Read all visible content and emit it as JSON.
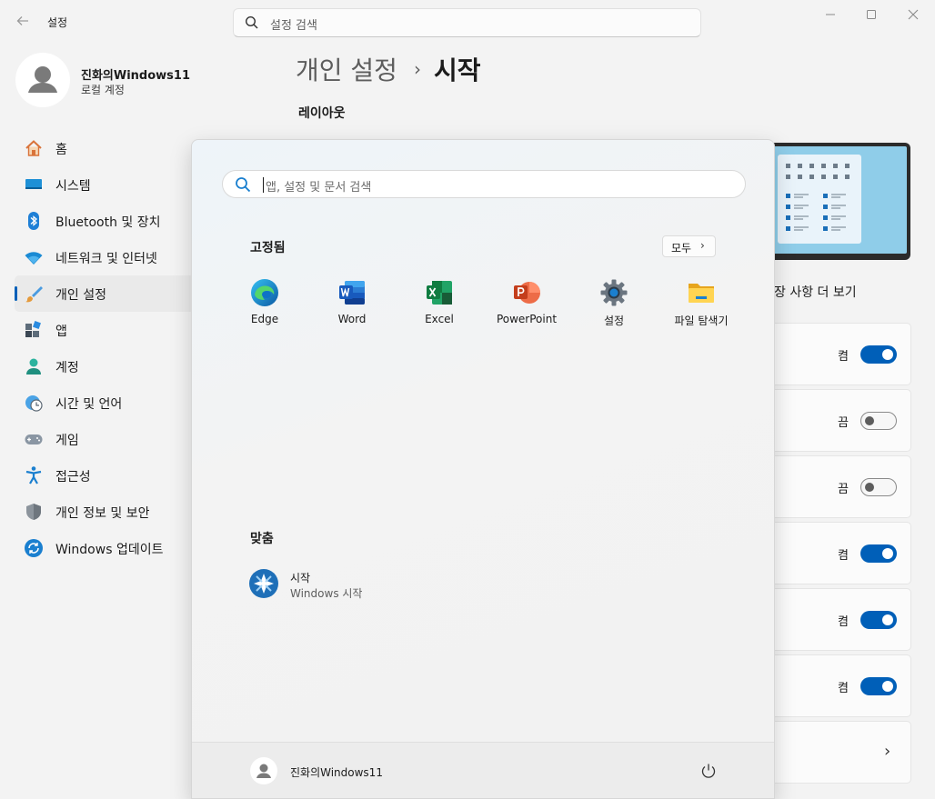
{
  "titlebar": {
    "app_title": "설정",
    "search_placeholder": "설정 검색"
  },
  "profile": {
    "name": "진화의Windows11",
    "account_type": "로컬 계정"
  },
  "sidebar": {
    "items": [
      {
        "label": "홈",
        "icon": "home-icon"
      },
      {
        "label": "시스템",
        "icon": "system-icon"
      },
      {
        "label": "Bluetooth 및 장치",
        "icon": "bluetooth-icon"
      },
      {
        "label": "네트워크 및 인터넷",
        "icon": "wifi-icon"
      },
      {
        "label": "개인 설정",
        "icon": "brush-icon",
        "active": true
      },
      {
        "label": "앱",
        "icon": "apps-icon"
      },
      {
        "label": "계정",
        "icon": "account-icon"
      },
      {
        "label": "시간 및 언어",
        "icon": "time-language-icon"
      },
      {
        "label": "게임",
        "icon": "gamepad-icon"
      },
      {
        "label": "접근성",
        "icon": "accessibility-icon"
      },
      {
        "label": "개인 정보 및 보안",
        "icon": "shield-icon"
      },
      {
        "label": "Windows 업데이트",
        "icon": "update-icon"
      }
    ]
  },
  "content": {
    "breadcrumb_parent": "개인 설정",
    "breadcrumb_current": "시작",
    "section_title": "레이아웃",
    "more_link": "장 사항 더 보기",
    "rows": [
      {
        "state": "켬",
        "on": true
      },
      {
        "state": "끔",
        "on": false
      },
      {
        "state": "끔",
        "on": false
      },
      {
        "state": "켬",
        "on": true
      },
      {
        "state": "켬",
        "on": true
      },
      {
        "state": "켬",
        "on": true
      }
    ]
  },
  "start_menu": {
    "search_placeholder": "앱, 설정 및 문서 검색",
    "pinned_title": "고정됨",
    "all_button": "모두",
    "pinned_apps": [
      {
        "name": "Edge",
        "icon": "edge-icon"
      },
      {
        "name": "Word",
        "icon": "word-icon"
      },
      {
        "name": "Excel",
        "icon": "excel-icon"
      },
      {
        "name": "PowerPoint",
        "icon": "powerpoint-icon"
      },
      {
        "name": "설정",
        "icon": "settings-gear-icon"
      },
      {
        "name": "파일 탐색기",
        "icon": "file-explorer-icon"
      }
    ],
    "recommended_title": "맞춤",
    "recommended": [
      {
        "title": "시작",
        "subtitle": "Windows 시작",
        "icon": "get-started-icon"
      }
    ],
    "footer_user": "진화의Windows11"
  },
  "colors": {
    "accent": "#005fb8",
    "background": "#f3f3f3"
  }
}
